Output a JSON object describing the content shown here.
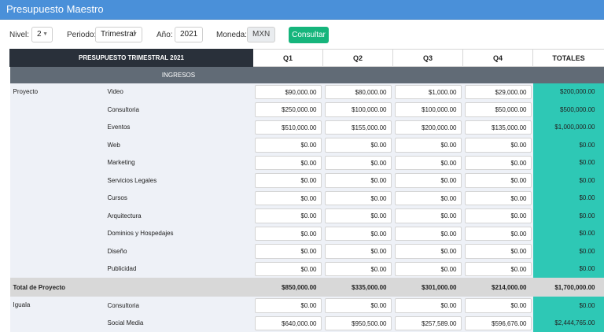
{
  "header": {
    "title": "Presupuesto Maestro"
  },
  "filters": {
    "nivel_label": "Nivel:",
    "nivel_value": "2",
    "periodo_label": "Periodo:",
    "periodo_value": "Trimestral",
    "anio_label": "Año:",
    "anio_value": "2021",
    "moneda_label": "Moneda:",
    "moneda_value": "MXN",
    "consultar_label": "Consultar"
  },
  "table": {
    "title": "PRESUPUESTO TRIMESTRAL 2021",
    "columns": [
      "Q1",
      "Q2",
      "Q3",
      "Q4",
      "TOTALES"
    ],
    "section": "INGRESOS",
    "groups": [
      {
        "name": "Proyecto",
        "rows": [
          {
            "label": "Video",
            "q1": "$90,000.00",
            "q2": "$80,000.00",
            "q3": "$1,000.00",
            "q4": "$29,000.00",
            "total": "$200,000.00"
          },
          {
            "label": "Consultoria",
            "q1": "$250,000.00",
            "q2": "$100,000.00",
            "q3": "$100,000.00",
            "q4": "$50,000.00",
            "total": "$500,000.00"
          },
          {
            "label": "Eventos",
            "q1": "$510,000.00",
            "q2": "$155,000.00",
            "q3": "$200,000.00",
            "q4": "$135,000.00",
            "total": "$1,000,000.00"
          },
          {
            "label": "Web",
            "q1": "$0.00",
            "q2": "$0.00",
            "q3": "$0.00",
            "q4": "$0.00",
            "total": "$0.00"
          },
          {
            "label": "Marketing",
            "q1": "$0.00",
            "q2": "$0.00",
            "q3": "$0.00",
            "q4": "$0.00",
            "total": "$0.00"
          },
          {
            "label": "Servicios Legales",
            "q1": "$0.00",
            "q2": "$0.00",
            "q3": "$0.00",
            "q4": "$0.00",
            "total": "$0.00"
          },
          {
            "label": "Cursos",
            "q1": "$0.00",
            "q2": "$0.00",
            "q3": "$0.00",
            "q4": "$0.00",
            "total": "$0.00"
          },
          {
            "label": "Arquitectura",
            "q1": "$0.00",
            "q2": "$0.00",
            "q3": "$0.00",
            "q4": "$0.00",
            "total": "$0.00"
          },
          {
            "label": "Dominios y Hospedajes",
            "q1": "$0.00",
            "q2": "$0.00",
            "q3": "$0.00",
            "q4": "$0.00",
            "total": "$0.00"
          },
          {
            "label": "Diseño",
            "q1": "$0.00",
            "q2": "$0.00",
            "q3": "$0.00",
            "q4": "$0.00",
            "total": "$0.00"
          },
          {
            "label": "Publicidad",
            "q1": "$0.00",
            "q2": "$0.00",
            "q3": "$0.00",
            "q4": "$0.00",
            "total": "$0.00"
          }
        ],
        "total_label": "Total de Proyecto",
        "total": {
          "q1": "$850,000.00",
          "q2": "$335,000.00",
          "q3": "$301,000.00",
          "q4": "$214,000.00",
          "total": "$1,700,000.00"
        }
      },
      {
        "name": "Iguala",
        "rows": [
          {
            "label": "Consultoria",
            "q1": "$0.00",
            "q2": "$0.00",
            "q3": "$0.00",
            "q4": "$0.00",
            "total": "$0.00"
          },
          {
            "label": "Social Media",
            "q1": "$640,000.00",
            "q2": "$950,500.00",
            "q3": "$257,589.00",
            "q4": "$596,676.00",
            "total": "$2,444,765.00"
          }
        ]
      }
    ]
  },
  "icons": {
    "select_caret": "chevron-down-icon"
  }
}
